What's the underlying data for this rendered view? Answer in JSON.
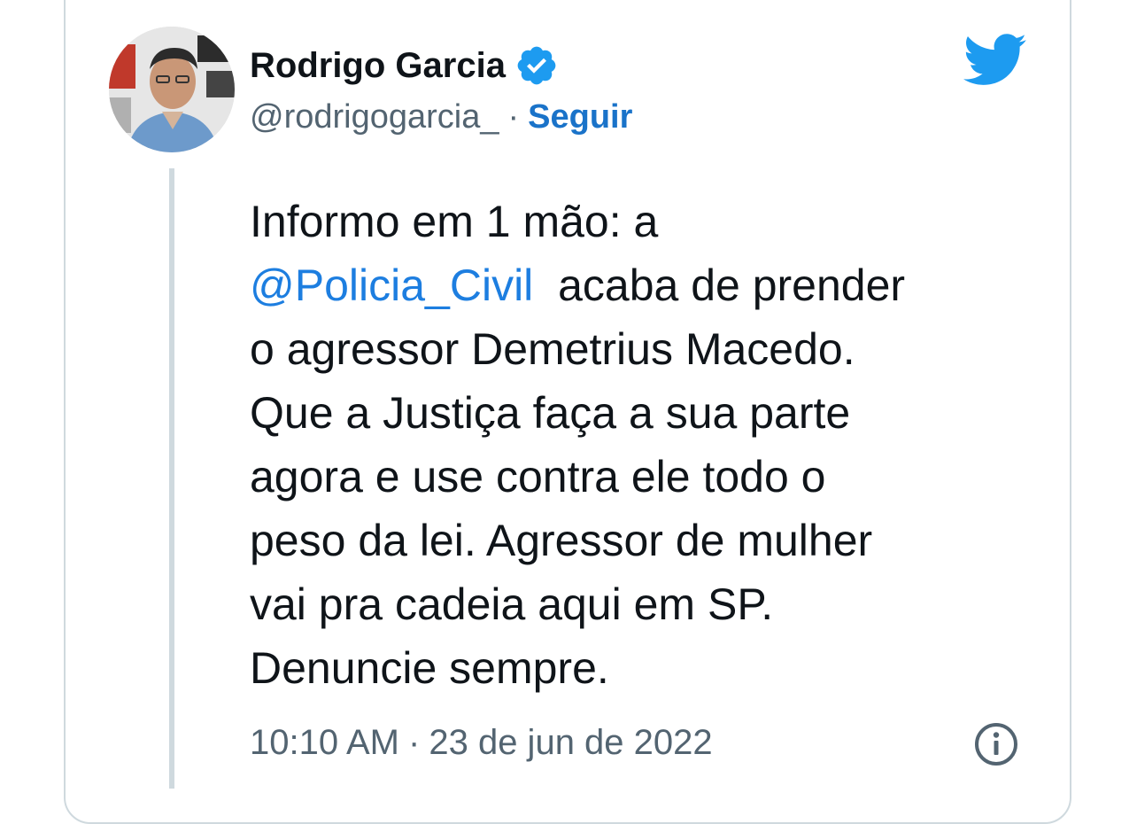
{
  "author": {
    "name": "Rodrigo Garcia",
    "handle": "@rodrigogarcia_",
    "separator": "·",
    "follow_label": "Seguir"
  },
  "icons": {
    "verified": "verified-badge-icon",
    "brand": "twitter-bird-icon",
    "info": "info-icon"
  },
  "colors": {
    "link": "#1d7ee0",
    "verified": "#1d9bf0",
    "brand": "#1d9bf0",
    "muted": "#536471"
  },
  "tweet": {
    "line1": "Informo em 1 mão: a",
    "mention": "@Policia_Civil",
    "line2_rest": "acaba de prender",
    "line3": "o agressor Demetrius Macedo.",
    "line4": "Que a Justiça faça a sua parte",
    "line5": "agora e use contra ele todo o",
    "line6": "peso da lei. Agressor de mulher",
    "line7": "vai pra cadeia aqui em SP.",
    "line8": "Denuncie sempre."
  },
  "meta": {
    "time": "10:10 AM",
    "separator": "·",
    "date": "23 de jun de 2022"
  }
}
